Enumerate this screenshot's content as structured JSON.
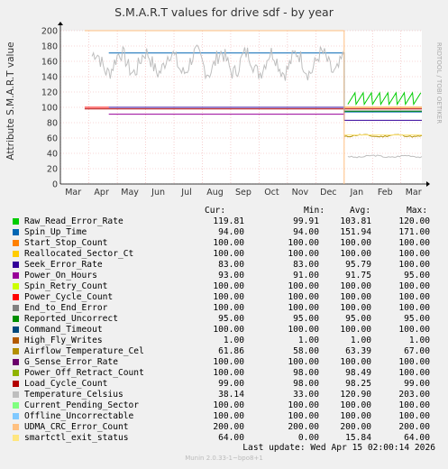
{
  "chart_data": {
    "type": "line",
    "title": "S.M.A.R.T values for drive sdf - by year",
    "ylabel": "Attribute S.M.A.R.T value",
    "ylim": [
      0,
      200
    ],
    "yticks": [
      0,
      20,
      40,
      60,
      80,
      100,
      120,
      140,
      160,
      180,
      200
    ],
    "x_tick_labels": [
      "Mar",
      "Apr",
      "May",
      "Jun",
      "Jul",
      "Aug",
      "Sep",
      "Oct",
      "Nov",
      "Dec",
      "Jan",
      "Feb",
      "Mar"
    ],
    "grid": true,
    "vertical_marker": "Jan",
    "columns": [
      "Cur:",
      "Min:",
      "Avg:",
      "Max:"
    ],
    "series": [
      {
        "name": "Raw_Read_Error_Rate",
        "color": "#00cc00",
        "cur": "119.81",
        "min": "99.91",
        "avg": "103.81",
        "max": "120.00"
      },
      {
        "name": "Spin_Up_Time",
        "color": "#0066b3",
        "cur": "94.00",
        "min": "94.00",
        "avg": "151.94",
        "max": "171.00"
      },
      {
        "name": "Start_Stop_Count",
        "color": "#ff8000",
        "cur": "100.00",
        "min": "100.00",
        "avg": "100.00",
        "max": "100.00"
      },
      {
        "name": "Reallocated_Sector_Ct",
        "color": "#ffcc00",
        "cur": "100.00",
        "min": "100.00",
        "avg": "100.00",
        "max": "100.00"
      },
      {
        "name": "Seek_Error_Rate",
        "color": "#330099",
        "cur": "83.00",
        "min": "83.00",
        "avg": "95.79",
        "max": "100.00"
      },
      {
        "name": "Power_On_Hours",
        "color": "#990099",
        "cur": "93.00",
        "min": "91.00",
        "avg": "91.75",
        "max": "95.00"
      },
      {
        "name": "Spin_Retry_Count",
        "color": "#ccff00",
        "cur": "100.00",
        "min": "100.00",
        "avg": "100.00",
        "max": "100.00"
      },
      {
        "name": "Power_Cycle_Count",
        "color": "#ff0000",
        "cur": "100.00",
        "min": "100.00",
        "avg": "100.00",
        "max": "100.00"
      },
      {
        "name": "End_to_End_Error",
        "color": "#808080",
        "cur": "100.00",
        "min": "100.00",
        "avg": "100.00",
        "max": "100.00"
      },
      {
        "name": "Reported_Uncorrect",
        "color": "#008f00",
        "cur": "95.00",
        "min": "95.00",
        "avg": "95.00",
        "max": "95.00"
      },
      {
        "name": "Command_Timeout",
        "color": "#00487d",
        "cur": "100.00",
        "min": "100.00",
        "avg": "100.00",
        "max": "100.00"
      },
      {
        "name": "High_Fly_Writes",
        "color": "#b35a00",
        "cur": "1.00",
        "min": "1.00",
        "avg": "1.00",
        "max": "1.00"
      },
      {
        "name": "Airflow_Temperature_Cel",
        "color": "#b38f00",
        "cur": "61.86",
        "min": "58.00",
        "avg": "63.39",
        "max": "67.00"
      },
      {
        "name": "G_Sense_Error_Rate",
        "color": "#6b006b",
        "cur": "100.00",
        "min": "100.00",
        "avg": "100.00",
        "max": "100.00"
      },
      {
        "name": "Power_Off_Retract_Count",
        "color": "#8fb300",
        "cur": "100.00",
        "min": "98.00",
        "avg": "98.49",
        "max": "100.00"
      },
      {
        "name": "Load_Cycle_Count",
        "color": "#b30000",
        "cur": "99.00",
        "min": "98.00",
        "avg": "98.25",
        "max": "99.00"
      },
      {
        "name": "Temperature_Celsius",
        "color": "#bebebe",
        "cur": "38.14",
        "min": "33.00",
        "avg": "120.90",
        "max": "203.00"
      },
      {
        "name": "Current_Pending_Sector",
        "color": "#80ff80",
        "cur": "100.00",
        "min": "100.00",
        "avg": "100.00",
        "max": "100.00"
      },
      {
        "name": "Offline_Uncorrectable",
        "color": "#80c9ff",
        "cur": "100.00",
        "min": "100.00",
        "avg": "100.00",
        "max": "100.00"
      },
      {
        "name": "UDMA_CRC_Error_Count",
        "color": "#ffc080",
        "cur": "200.00",
        "min": "200.00",
        "avg": "200.00",
        "max": "200.00"
      },
      {
        "name": "smartctl_exit_status",
        "color": "#ffe680",
        "cur": "64.00",
        "min": "0.00",
        "avg": "15.84",
        "max": "64.00"
      }
    ]
  },
  "last_update": "Last update:  Wed Apr 15 02:00:14 2026",
  "vendor_text": "RRDTOOL / TOBI OETIKER",
  "footer": "Munin 2.0.33-1~bpo8+1"
}
